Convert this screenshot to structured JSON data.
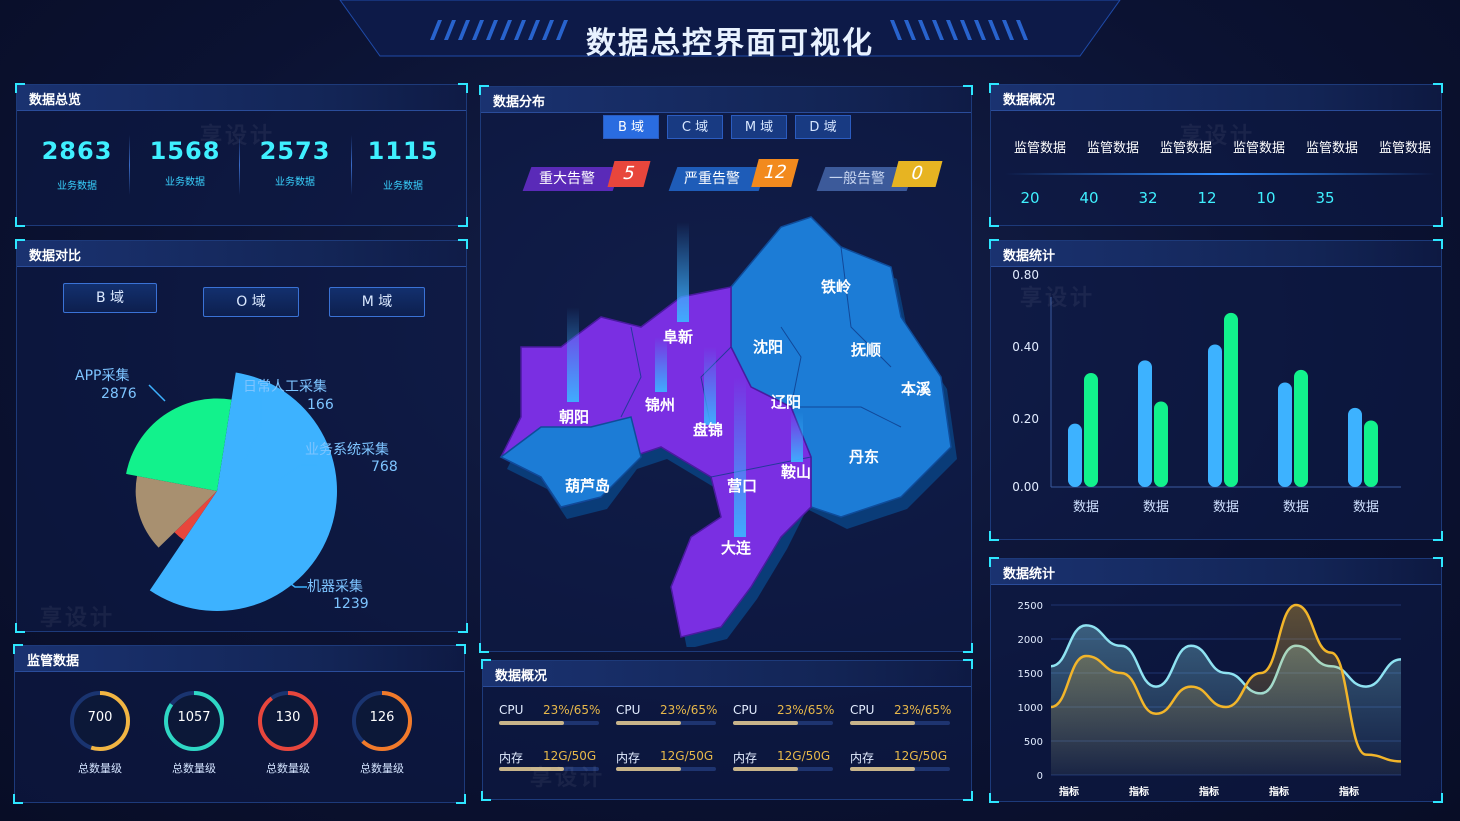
{
  "header": {
    "title": "数据总控界面可视化"
  },
  "overview": {
    "title": "数据总览",
    "items": [
      {
        "value": "2863",
        "label": "业务数据"
      },
      {
        "value": "1568",
        "label": "业务数据"
      },
      {
        "value": "2573",
        "label": "业务数据"
      },
      {
        "value": "1115",
        "label": "业务数据"
      }
    ]
  },
  "compare": {
    "title": "数据对比",
    "tabs": [
      "B 域",
      "O 域",
      "M 域"
    ],
    "pie": [
      {
        "name": "APP采集",
        "value": 2876,
        "color": "#3db2ff"
      },
      {
        "name": "日常人工采集",
        "value": 166,
        "color": "#e8463c"
      },
      {
        "name": "业务系统采集",
        "value": 768,
        "color": "#a89070"
      },
      {
        "name": "机器采集",
        "value": 1239,
        "color": "#12f28c"
      }
    ],
    "labels": {
      "app": {
        "name": "APP采集",
        "value": "2876"
      },
      "manual": {
        "name": "日常人工采集",
        "value": "166"
      },
      "system": {
        "name": "业务系统采集",
        "value": "768"
      },
      "machine": {
        "name": "机器采集",
        "value": "1239"
      }
    }
  },
  "supervise": {
    "title": "监管数据",
    "rings": [
      {
        "value": "700",
        "label": "总数量级",
        "color": "#f2b542",
        "pct": 0.55
      },
      {
        "value": "1057",
        "label": "总数量级",
        "color": "#2fd7c4",
        "pct": 0.85
      },
      {
        "value": "130",
        "label": "总数量级",
        "color": "#e8463c",
        "pct": 0.9
      },
      {
        "value": "126",
        "label": "总数量级",
        "color": "#f27a2a",
        "pct": 0.62
      }
    ]
  },
  "distribution": {
    "title": "数据分布",
    "tabs": [
      "B 域",
      "C 域",
      "M 域",
      "D 域"
    ],
    "alerts": [
      {
        "label": "重大告警",
        "count": "5",
        "color": "#e8463c"
      },
      {
        "label": "严重告警",
        "count": "12",
        "color": "#f28a1e"
      },
      {
        "label": "一般告警",
        "count": "0",
        "color": "#e7b422"
      }
    ],
    "cities": [
      "阜新",
      "铁岭",
      "沈阳",
      "抚顺",
      "朝阳",
      "锦州",
      "辽阳",
      "本溪",
      "盘锦",
      "鞍山",
      "丹东",
      "葫芦岛",
      "营口",
      "大连"
    ]
  },
  "system": {
    "title": "数据概况",
    "cpu_label": "CPU",
    "cpu_value": "23%/65%",
    "cpu_pct": 0.65,
    "mem_label": "内存",
    "mem_value": "12G/50G",
    "mem_pct": 0.65
  },
  "summary": {
    "title": "数据概况",
    "headers": [
      "监管数据",
      "监管数据",
      "监管数据",
      "监管数据",
      "监管数据",
      "监管数据"
    ],
    "values": [
      "20",
      "40",
      "32",
      "12",
      "10",
      "35"
    ]
  },
  "chart_data": [
    {
      "type": "bar",
      "title": "数据统计",
      "categories": [
        "数据",
        "数据",
        "数据",
        "数据",
        "数据"
      ],
      "series": [
        {
          "values": [
            0.2,
            0.4,
            0.45,
            0.33,
            0.25
          ],
          "color": "#3db2ff"
        },
        {
          "values": [
            0.36,
            0.27,
            0.55,
            0.37,
            0.21
          ],
          "color": "#12f28c"
        }
      ],
      "yticks": [
        "0.00",
        "0.20",
        "0.40",
        "0.80"
      ],
      "ylim": [
        0,
        0.6
      ],
      "grid": false
    },
    {
      "type": "area",
      "title": "数据统计",
      "categories": [
        "指标",
        "指标",
        "指标",
        "指标",
        "指标"
      ],
      "yticks": [
        "0",
        "500",
        "1000",
        "1500",
        "2000",
        "2500"
      ],
      "ylim": [
        0,
        2500
      ],
      "series": [
        {
          "x": [
            0,
            0.5,
            1,
            1.5,
            2,
            2.5,
            3,
            3.5,
            4,
            4.5,
            5
          ],
          "values": [
            1600,
            2200,
            1900,
            1300,
            1900,
            1500,
            1200,
            1900,
            1600,
            1300,
            1700
          ],
          "color": "#8fe3f2"
        },
        {
          "x": [
            0,
            0.5,
            1,
            1.5,
            2,
            2.5,
            3,
            3.5,
            4,
            4.5,
            5
          ],
          "values": [
            1000,
            1750,
            1500,
            900,
            1300,
            1000,
            1500,
            2500,
            1800,
            300,
            200
          ],
          "color": "#f2b52a"
        }
      ],
      "grid": true
    }
  ],
  "watermark": "享设计"
}
